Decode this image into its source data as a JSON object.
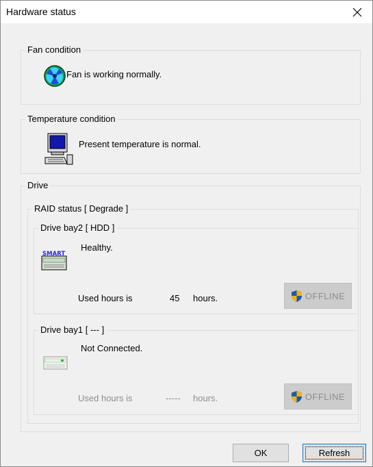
{
  "window": {
    "title": "Hardware status"
  },
  "fan": {
    "legend": "Fan condition",
    "status": "Fan is working normally.",
    "icon": "fan-icon"
  },
  "temperature": {
    "legend": "Temperature condition",
    "status": "Present temperature is normal.",
    "icon": "computer-icon"
  },
  "drive": {
    "legend": "Drive",
    "raid_legend": "RAID status [ Degrade ]",
    "bays": [
      {
        "legend": "Drive bay2 [ HDD ]",
        "status": "Healthy.",
        "used_label": "Used hours is",
        "used_value": "45",
        "used_unit": "hours.",
        "offline_label": "OFFLINE",
        "icon": "smart-drive-icon"
      },
      {
        "legend": "Drive bay1 [ --- ]",
        "status": "Not Connected.",
        "used_label": "Used hours is",
        "used_value": "-----",
        "used_unit": "hours.",
        "offline_label": "OFFLINE",
        "icon": "drive-disconnected-icon"
      }
    ]
  },
  "buttons": {
    "ok": "OK",
    "refresh": "Refresh"
  },
  "colors": {
    "titlebar": "#ffffff",
    "background": "#f0f0f0",
    "shield_blue": "#1e5aa8",
    "shield_gold": "#f2b01e"
  }
}
